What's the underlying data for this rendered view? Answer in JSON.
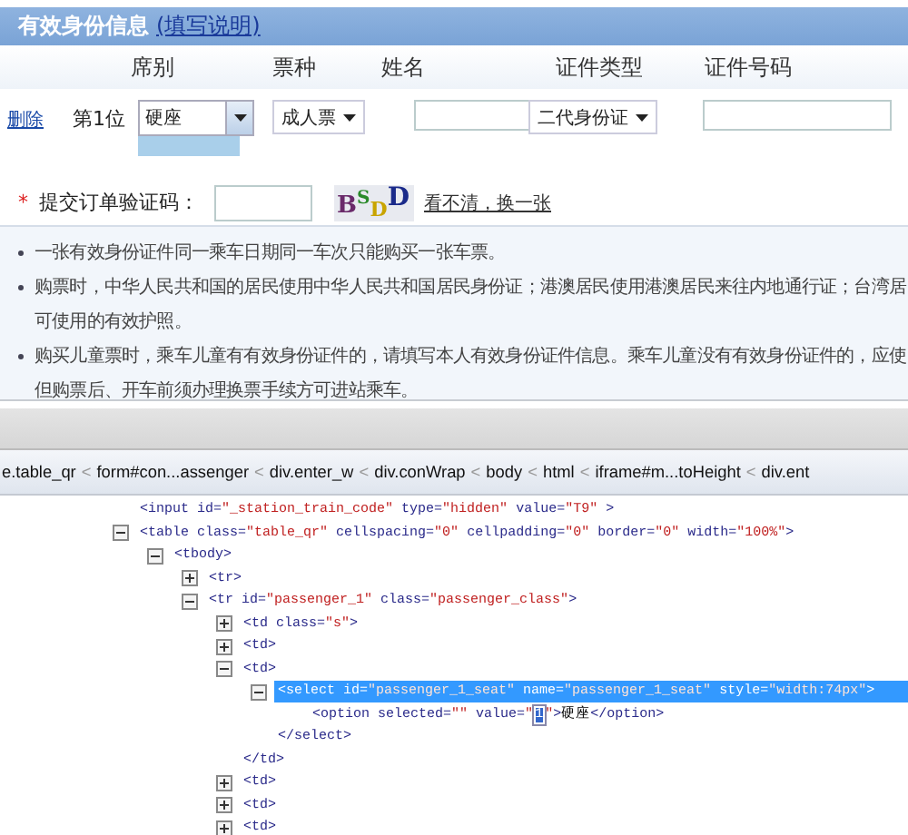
{
  "form": {
    "title": "有效身份信息",
    "help_link": "(填写说明)",
    "columns": [
      "席别",
      "票种",
      "姓名",
      "证件类型",
      "证件号码"
    ],
    "passenger": {
      "delete_link": "删除",
      "position": "第1位",
      "seat": {
        "value": "硬座",
        "open": true
      },
      "ticket_type": "成人票",
      "id_type": "二代身份证"
    },
    "captcha": {
      "required_mark": "*",
      "label": "提交订单验证码：",
      "image_text": "BSDD",
      "refresh_link": "看不清，换一张"
    },
    "notes": [
      {
        "lines": [
          "一张有效身份证件同一乘车日期同一车次只能购买一张车票。"
        ]
      },
      {
        "lines": [
          "购票时，中华人民共和国的居民使用中华人民共和国居民身份证；港澳居民使用港澳居民来往内地通行证；台湾居",
          "可使用的有效护照。"
        ]
      },
      {
        "lines": [
          "购买儿童票时，乘车儿童有有效身份证件的，请填写本人有效身份证件信息。乘车儿童没有有效身份证件的，应使",
          "但购票后、开车前须办理换票手续方可进站乘车。"
        ]
      }
    ]
  },
  "devtools": {
    "breadcrumbs": [
      {
        "label": "e.table_qr",
        "separator": "<"
      },
      {
        "label": "form#con...assenger",
        "separator": "<"
      },
      {
        "label": "div.enter_w",
        "separator": "<"
      },
      {
        "label": "div.conWrap",
        "separator": "<"
      },
      {
        "label": "body",
        "separator": "<"
      },
      {
        "label": "html",
        "separator": "<"
      },
      {
        "label": "iframe#m...toHeight",
        "separator": "<"
      },
      {
        "label": "div.ent"
      }
    ],
    "tree": [
      {
        "selected": false,
        "parts": [
          {
            "kind": "tag",
            "text": "<input id="
          },
          {
            "kind": "value",
            "text": "\"_station_train_code\""
          },
          {
            "kind": "tag",
            "text": " type="
          },
          {
            "kind": "value",
            "text": "\"hidden\""
          },
          {
            "kind": "tag",
            "text": " value="
          },
          {
            "kind": "value",
            "text": "\"T9\""
          },
          {
            "kind": "tag",
            "text": " >"
          }
        ]
      },
      {
        "selected": false,
        "expanded": true,
        "parts": [
          {
            "kind": "tag",
            "text": "<table class="
          },
          {
            "kind": "value",
            "text": "\"table_qr\""
          },
          {
            "kind": "tag",
            "text": " cellspacing="
          },
          {
            "kind": "value",
            "text": "\"0\""
          },
          {
            "kind": "tag",
            "text": " cellpadding="
          },
          {
            "kind": "value",
            "text": "\"0\""
          },
          {
            "kind": "tag",
            "text": " border="
          },
          {
            "kind": "value",
            "text": "\"0\""
          },
          {
            "kind": "tag",
            "text": " width="
          },
          {
            "kind": "value",
            "text": "\"100%\""
          },
          {
            "kind": "tag",
            "text": ">"
          }
        ],
        "children": [
          {
            "selected": false,
            "expanded": true,
            "parts": [
              {
                "kind": "tag",
                "text": "<tbody>"
              }
            ],
            "children": [
              {
                "selected": false,
                "expanded": false,
                "parts": [
                  {
                    "kind": "tag",
                    "text": "<tr>"
                  }
                ]
              },
              {
                "selected": false,
                "expanded": true,
                "parts": [
                  {
                    "kind": "tag",
                    "text": "<tr id="
                  },
                  {
                    "kind": "value",
                    "text": "\"passenger_1\""
                  },
                  {
                    "kind": "tag",
                    "text": " class="
                  },
                  {
                    "kind": "value",
                    "text": "\"passenger_class\""
                  },
                  {
                    "kind": "tag",
                    "text": ">"
                  }
                ],
                "children": [
                  {
                    "selected": false,
                    "expanded": false,
                    "parts": [
                      {
                        "kind": "tag",
                        "text": "<td class="
                      },
                      {
                        "kind": "value",
                        "text": "\"s\""
                      },
                      {
                        "kind": "tag",
                        "text": ">"
                      }
                    ]
                  },
                  {
                    "selected": false,
                    "expanded": false,
                    "parts": [
                      {
                        "kind": "tag",
                        "text": "<td>"
                      }
                    ]
                  },
                  {
                    "selected": false,
                    "expanded": true,
                    "parts": [
                      {
                        "kind": "tag",
                        "text": "<td>"
                      }
                    ],
                    "children": [
                      {
                        "selected": true,
                        "expanded": true,
                        "parts": [
                          {
                            "kind": "tag",
                            "text": "<select id="
                          },
                          {
                            "kind": "value",
                            "text": "\"passenger_1_seat\""
                          },
                          {
                            "kind": "tag",
                            "text": " name="
                          },
                          {
                            "kind": "value",
                            "text": "\"passenger_1_seat\""
                          },
                          {
                            "kind": "tag",
                            "text": " style="
                          },
                          {
                            "kind": "value",
                            "text": "\"width:74px\""
                          },
                          {
                            "kind": "tag",
                            "text": ">"
                          }
                        ],
                        "children": [
                          {
                            "selected": false,
                            "parts": [
                              {
                                "kind": "tag",
                                "text": "<option selected="
                              },
                              {
                                "kind": "value",
                                "text": "\"\""
                              },
                              {
                                "kind": "tag",
                                "text": " value="
                              },
                              {
                                "kind": "value",
                                "text": "\""
                              },
                              {
                                "kind": "edit",
                                "text": "1"
                              },
                              {
                                "kind": "value",
                                "text": "\""
                              },
                              {
                                "kind": "tag",
                                "text": ">"
                              },
                              {
                                "kind": "text",
                                "text": "硬座"
                              },
                              {
                                "kind": "tag",
                                "text": "</option>"
                              }
                            ]
                          }
                        ],
                        "closing": [
                          {
                            "kind": "tag",
                            "text": "</select>"
                          }
                        ]
                      }
                    ],
                    "closing": [
                      {
                        "kind": "tag",
                        "text": "</td>"
                      }
                    ]
                  },
                  {
                    "selected": false,
                    "expanded": false,
                    "parts": [
                      {
                        "kind": "tag",
                        "text": "<td>"
                      }
                    ]
                  },
                  {
                    "selected": false,
                    "expanded": false,
                    "parts": [
                      {
                        "kind": "tag",
                        "text": "<td>"
                      }
                    ]
                  },
                  {
                    "selected": false,
                    "expanded": false,
                    "parts": [
                      {
                        "kind": "tag",
                        "text": "<td>"
                      }
                    ]
                  }
                ]
              }
            ]
          }
        ]
      }
    ]
  }
}
